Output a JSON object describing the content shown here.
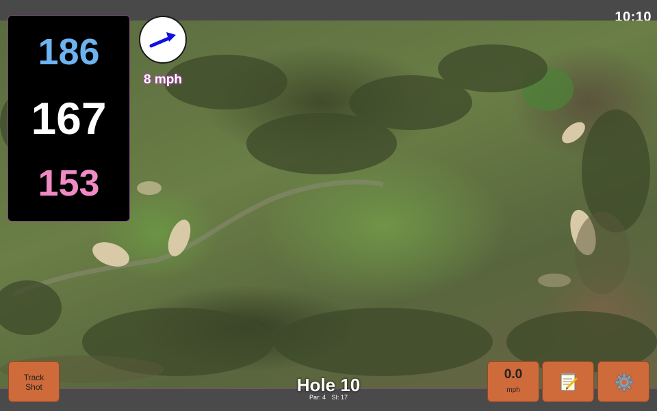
{
  "status": {
    "time": "10:10"
  },
  "distances": {
    "back": "186",
    "center": "167",
    "front": "153"
  },
  "wind": {
    "speed": "8 mph",
    "arrow_icon": "wind-direction-arrow-icon",
    "arrow_color": "#1010e0"
  },
  "buttons": {
    "track_shot": "Track\nShot",
    "speed_value": "0.0",
    "speed_unit": "mph",
    "notes_icon": "notepad-icon",
    "settings_icon": "gear-icon"
  },
  "hole": {
    "title": "Hole 10",
    "par": "Par: 4",
    "si": "SI: 17"
  },
  "colors": {
    "back": "#6db3f0",
    "center": "#ffffff",
    "front": "#f08ac4",
    "button": "#cf6a3a",
    "wind_glow": "#b040b0"
  }
}
